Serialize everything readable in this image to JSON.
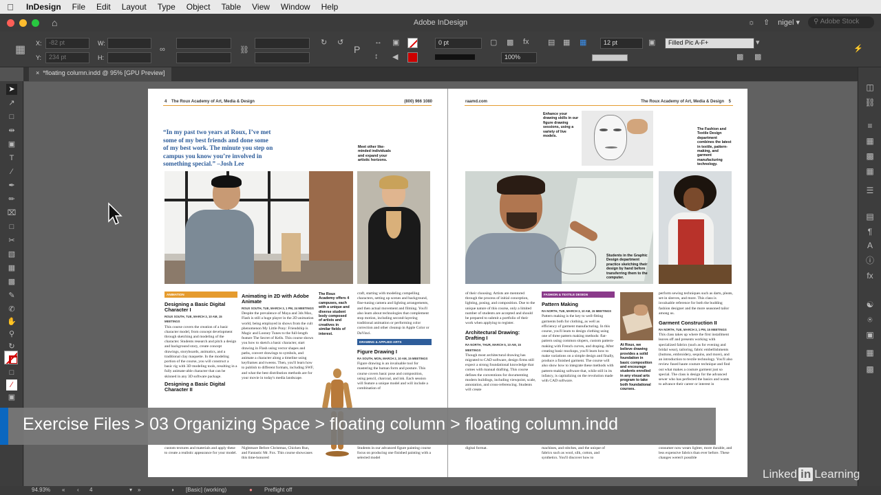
{
  "menubar": {
    "app": "InDesign",
    "items": [
      "File",
      "Edit",
      "Layout",
      "Type",
      "Object",
      "Table",
      "View",
      "Window",
      "Help"
    ]
  },
  "titlebar": {
    "title": "Adobe InDesign",
    "user": "nigel",
    "search_placeholder": "Adobe Stock"
  },
  "control_panel": {
    "x_label": "X:",
    "x_value": "-82 pt",
    "y_label": "Y:",
    "y_value": "234 pt",
    "w_label": "W:",
    "h_label": "H:",
    "stroke_weight": "0 pt",
    "opacity": "100%",
    "gutter": "12 pt",
    "object_style": "Filled Pic A-F+"
  },
  "doc_tab": {
    "label": "*floating column.indd @ 95% [GPU Preview]"
  },
  "left_page": {
    "folio": "4",
    "school": "The Roux Academy of Art, Media & Design",
    "phone": "(800) 966 1080",
    "quote": "“In my past two years at Roux, I’ve met some of my best friends and done some of my best work. The minute you step on campus you know you’re involved in something special.” –Josh Lee",
    "sidebar_top": "Meet other like-minded individuals and expand your artistic horizons.",
    "sidebar_mid": "The Roux Academy offers 4 campuses, each with a unique and diverse student body composed of artists and creatives in similar fields of interest.",
    "col1_category": "ANIMATION",
    "col1_heading": "Designing a Basic Digital Character I",
    "col1_meta": "ROUX SOUTH, TUE, MARCH 3, 10 AM, 15 MEETINGS",
    "col1_body": "This course covers the creation of a basic character model, from concept development through sketching and modeling of the character. Students research and pitch a design and background story, create concept drawings, storyboards, animatics, and a traditional clay maquette. In the modeling portion of the course, you will construct a basic rig with 3D modeling tools, resulting in a fully animate-able character that can be skinned in any 3D software package.",
    "col1_heading2": "Designing a Basic Digital Character II",
    "col1_tail": "custom textures and materials and apply these to create a realistic appearance for your model.",
    "col2_heading": "Animating in 2D with Adobe Animate",
    "col2_meta": "ROUX SOUTH, TUE, MARCH 3, 1 PM, 24 MEETINGS",
    "col2_body": "Despite the prevalence of Maya and 3ds Max, Flash is still a huge player in the 2D animation world, being employed in shows from the cult phenomenon My Little Pony: Friendship is Magic and Looney Tunes to the full-length feature The Secret of Kells. This course shows you how to sketch a basic character, start drawing in Flash using vector shapes and paths, convert drawings to symbols, and animate a character along a timeline using keyframes and tweens. Then, you'll learn how to publish to different formats, including SWF, and what the best distribution methods are for your movie in today's media landscape.",
    "col2_tail": "Nightmare Before Christmas, Chicken Run, and Fantastic Mr. Fox. This course showcases this time-honored",
    "col3_body": "craft, starting with modeling compelling characters, setting up scenes and background, fine-tuning camera and lighting arrangements, and then actual movement and filming. You'll also learn about technologies that complement stop motion, including second-layering traditional animation or performing color correction and other cleanup in Apple Color or DaVinci.",
    "col3_category": "DRAWING & APPLIED ARTS",
    "col3_heading": "Figure Drawing I",
    "col3_meta": "RA SOUTH, MON, MARCH 2, 10 AM, 15 MEETINGS",
    "col3_body2": "Figure drawing is an invaluable tool for mastering the human form and posture. This course covers basic pose and composition, using pencil, charcoal, and ink. Each session will feature a unique model and will include a combination of",
    "col3_tail": "Students in our advanced figure painting course focus on producing one finished painting with a selected model"
  },
  "right_page": {
    "folio": "5",
    "url": "raamd.com",
    "school": "The Roux Academy of Art, Media & Design",
    "sidebar_top": "Enhance your drawing skills in our figure drawing sessions, using a variety of live models.",
    "sidebar_right": "The Fashion and Textile Design department combines the latest in textile, pattern-making, and garment manufacturing technology.",
    "caption_graphic": "Students in the Graphic Design department practice sketching their design by hand before transferring them to the computer.",
    "caption_roux": "At Roux, we believe drawing provides a solid foundation in basic composition and encourage students enrolled in any visual arts program to take both foundational courses.",
    "col1_body": "of their choosing. Artists are mentored through the process of initial conception, lighting, posing, and composition. Due to the unique nature of this course, only a limited number of students are accepted and should be prepared to submit a portfolio of their work when applying to register.",
    "col1_heading": "Architectural Drawing: Drafting I",
    "col1_meta": "RA NORTH, THUR, MARCH 5, 10 AM, 15 MEETINGS",
    "col1_body2": "Though most architectural drawing has migrated to CAD software, design firms still expect a strong foundational knowledge that comes with manual drafting. This course defines the conventions for documenting modern buildings, including viewpoint, scale, annotation, and cross-referencing. Students will create",
    "col1_tail": "digital format.",
    "col2_category": "FASHION & TEXTILE DESIGN",
    "col2_heading": "Pattern Making",
    "col2_meta": "RA NORTH, TUE, MARCH 3, 10 AM, 15 MEETINGS",
    "col2_body": "Pattern making is the key to well-fitting garments both for clothing, as well as efficiency of garment manufacturing. In this course, you'll learn to design clothing using one of three pattern making methods: flat-pattern using common slopers, custom pattern-making with French curves, and draping. After creating basic mockups, you'll learn how to make variations on a simple design and finally, produce a finished garment. The course will also show how to integrate these methods with pattern-making software that, while still in its infancy, is capitalizing on the revolution made with CAD software.",
    "col2_tail": "machines, and stitches, and the unique of fabrics such as wool, silk, cotton, and synthetics. You'll discover how to",
    "col3_body": "perform sewing techniques such as darts, pleats, set-in sleeves, and more. This class is invaluable reference for both the budding fashion designer and the more seasoned tailor among us.",
    "col3_heading": "Garment Construction II",
    "col3_meta": "RA NORTH, TUE, MARCH 3, 1 PM, 15 MEETINGS",
    "col3_body2": "This class takes up where the first installment leaves off and presents working with specialized fabrics (such as for evening and bridal wear), tailoring, fabric embellishments (buttons, embroidery, sequins, and more), and an introduction to textile technology. You'll also review fused haute couture technique and find out what makes a couture garment just so special. The class is design for the advanced sewer who has perfected the basics and wants to advance their career or interest in",
    "col3_tail": "consumer now wears lighter, more durable, and less expensive fabrics than ever before. These changes weren't possible"
  },
  "banner": {
    "path": "Exercise Files > 03 Organizing Space > floating column > floating column.indd"
  },
  "statusbar": {
    "zoom": "94.93%",
    "page": "4",
    "style": "[Basic] (working)",
    "preflight": "Preflight off"
  },
  "watermark": {
    "left": "Linked",
    "badge": "in",
    "right": "Learning"
  }
}
